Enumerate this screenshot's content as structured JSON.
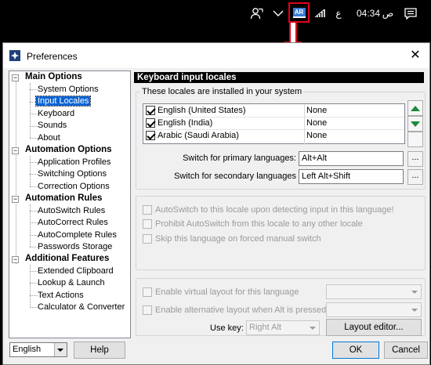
{
  "taskbar": {
    "people_icon": "people-icon",
    "chevron_icon": "chevron-up-icon",
    "lang_badge": "AR",
    "wifi_icon": "wifi-icon",
    "ime_char": "ع",
    "time": "04:34",
    "ampm": "ص",
    "notification_icon": "notification-icon"
  },
  "window": {
    "title": "Preferences",
    "close": "✕"
  },
  "tree": {
    "categories": [
      {
        "label": "Main Options",
        "items": [
          "System Options",
          "Input Locales",
          "Keyboard",
          "Sounds",
          "About"
        ]
      },
      {
        "label": "Automation Options",
        "items": [
          "Application Profiles",
          "Switching Options",
          "Correction Options"
        ]
      },
      {
        "label": "Automation Rules",
        "items": [
          "AutoSwitch Rules",
          "AutoCorrect Rules",
          "AutoComplete Rules",
          "Passwords Storage"
        ]
      },
      {
        "label": "Additional Features",
        "items": [
          "Extended Clipboard",
          "Lookup & Launch",
          "Text Actions",
          "Calculator & Converter"
        ]
      }
    ],
    "selected": "Input Locales",
    "expander": "−"
  },
  "panel": {
    "header": "Keyboard input locales",
    "group_title": "These locales are installed in your system",
    "locales": [
      {
        "name": "English (United States)",
        "switch": "None",
        "checked": true
      },
      {
        "name": "English (India)",
        "switch": "None",
        "checked": true
      },
      {
        "name": "Arabic (Saudi Arabia)",
        "switch": "None",
        "checked": true
      }
    ],
    "primary_label": "Switch for primary languages:",
    "primary_value": "Alt+Alt",
    "secondary_label": "Switch for secondary languages",
    "secondary_value": "Left Alt+Shift",
    "dots": "...",
    "autoswitch_options": [
      "AutoSwitch to this locale upon detecting input in this language!",
      "Prohibit AutoSwitch from this locale to any other locale",
      "Skip this language on forced manual switch"
    ],
    "virtual_layout_label": "Enable virtual layout for this language",
    "alt_layout_label": "Enable alternative layout when Alt is pressed",
    "use_key_label": "Use key:",
    "use_key_value": "Right Alt",
    "layout_editor": "Layout editor..."
  },
  "footer": {
    "language": "English",
    "help": "Help",
    "ok": "OK",
    "cancel": "Cancel"
  },
  "colors": {
    "accent": "#0a64d6",
    "annotation": "#e0001b",
    "arrow_green": "#1b8a3a"
  }
}
